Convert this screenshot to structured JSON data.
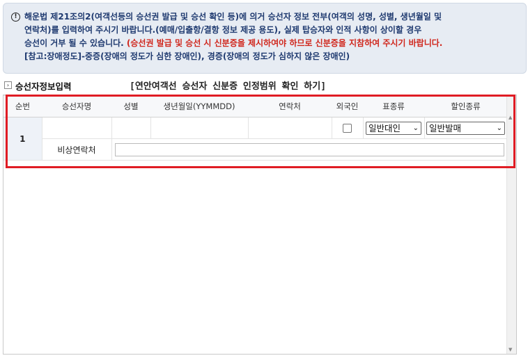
{
  "notice": {
    "line1": "해운법 제21조의2(여객선등의 승선권 발급 및 승선 확인 등)에 의거 승선자 정보 전부(여객의 성명, 성별, 생년월일 및",
    "line2": "연락처)를 입력하여 주시기 바랍니다.(예매/입출항/결항 정보 제공 용도), 실제 탑승자와 인적 사항이 상이할 경우",
    "line3_prefix": "승선이 거부 될 수 있습니다.",
    "line3_red": "(승선권 발급 및 승선 시 신분증을 제시하여야 하므로 신분증을 지참하여 주시기 바랍니다.",
    "line4": "[참고:장애정도]-중증(장애의 정도가 심한 장애인), 경증(장애의 정도가 심하지 않은 장애인)",
    "icon": "!"
  },
  "section": {
    "arrow": "›",
    "title": "승선자정보입력",
    "link": "[연안여객선 승선자 신분증 인정범위 확인 하기]"
  },
  "table": {
    "headers": [
      "순번",
      "승선자명",
      "성별",
      "생년월일(YYMMDD)",
      "연락처",
      "외국인",
      "표종류",
      "할인종류"
    ],
    "row": {
      "seq": "1",
      "name": "",
      "gender": "",
      "birth": "",
      "phone": "",
      "ticket_type": "일반대인",
      "discount_type": "일반발매",
      "emergency_label": "비상연락처",
      "emergency_value": ""
    }
  },
  "scroll": {
    "up": "▲",
    "down": "▼"
  },
  "colors": {
    "highlight": "#e01c24",
    "notice_bg": "#e7ecf3",
    "notice_text": "#1f3a70",
    "red_text": "#d0271d"
  }
}
